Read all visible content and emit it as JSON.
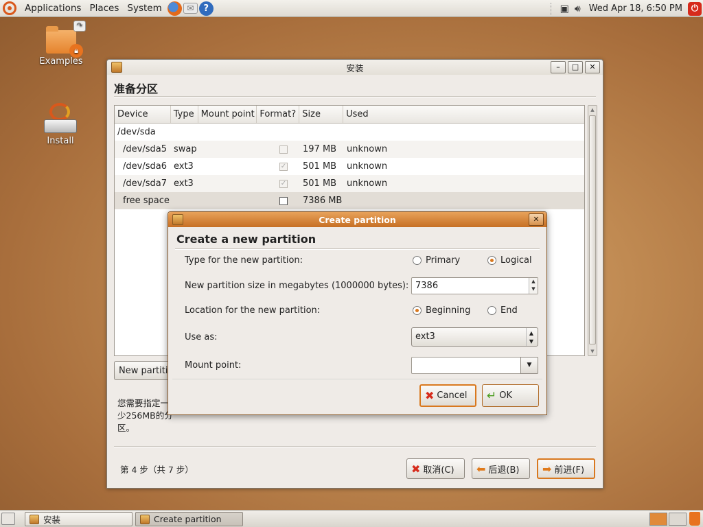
{
  "top_panel": {
    "menus": [
      "Applications",
      "Places",
      "System"
    ],
    "clock": "Wed Apr 18,  6:50 PM"
  },
  "desktop": {
    "icons": [
      {
        "label": "Examples"
      },
      {
        "label": "Install"
      }
    ]
  },
  "main_window": {
    "title": "安装",
    "heading": "准备分区",
    "controls": {
      "minimize": "–",
      "maximize": "□",
      "close": "✕"
    },
    "table": {
      "columns": [
        "Device",
        "Type",
        "Mount point",
        "Format?",
        "Size",
        "Used"
      ],
      "rows": [
        {
          "device": "/dev/sda",
          "type": "",
          "mount": "",
          "format": "none",
          "size": "",
          "used": ""
        },
        {
          "device": "/dev/sda5",
          "type": "swap",
          "mount": "",
          "format": "unchecked",
          "size": "197 MB",
          "used": "unknown"
        },
        {
          "device": "/dev/sda6",
          "type": "ext3",
          "mount": "",
          "format": "checked",
          "size": "501 MB",
          "used": "unknown"
        },
        {
          "device": "/dev/sda7",
          "type": "ext3",
          "mount": "",
          "format": "checked",
          "size": "501 MB",
          "used": "unknown"
        },
        {
          "device": "free space",
          "type": "",
          "mount": "",
          "format": "unchecked",
          "size": "7386 MB",
          "used": ""
        }
      ]
    },
    "new_partition_button": "New partiti",
    "help_line1": "您需要指定一",
    "help_line2": "少256MB的分",
    "help_line3": "区。",
    "step_text": "第 4 步（共 7 步）",
    "buttons": {
      "cancel": "取消(C)",
      "back": "后退(B)",
      "forward": "前进(F)"
    }
  },
  "dialog": {
    "title": "Create partition",
    "close": "✕",
    "heading": "Create a new partition",
    "type_label": "Type for the new partition:",
    "type_options": [
      "Primary",
      "Logical"
    ],
    "type_selected": "Logical",
    "size_label": "New partition size in megabytes (1000000 bytes):",
    "size_value": "7386",
    "location_label": "Location for the new partition:",
    "location_options": [
      "Beginning",
      "End"
    ],
    "location_selected": "Beginning",
    "use_as_label": "Use as:",
    "use_as_value": "ext3",
    "mount_label": "Mount point:",
    "mount_value": "",
    "cancel_label": "Cancel",
    "ok_label": "OK"
  },
  "taskbar": {
    "tasks": [
      {
        "label": "安装"
      },
      {
        "label": "Create partition"
      }
    ]
  },
  "colors": {
    "accent": "#d9781e",
    "dialog_title": "#c66f24",
    "desktop": "#c08a52"
  }
}
